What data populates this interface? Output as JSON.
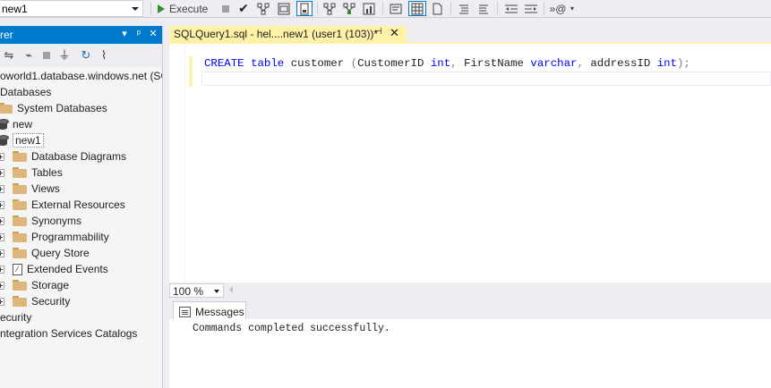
{
  "toolbar": {
    "database": "new1",
    "execute_label": "Execute"
  },
  "object_explorer": {
    "title": "rer",
    "pin_glyph": "▼ ⊥ ✕",
    "server": "oworld1.database.windows.net (SQ",
    "tree": [
      {
        "label": "Databases",
        "kind": "text",
        "indent": 0
      },
      {
        "label": "System Databases",
        "kind": "folder",
        "indent": 1
      },
      {
        "label": "new",
        "kind": "db",
        "indent": 1
      },
      {
        "label": "new1",
        "kind": "db",
        "indent": 1,
        "selected": true
      },
      {
        "label": "Database Diagrams",
        "kind": "folder",
        "indent": 2,
        "expand": true
      },
      {
        "label": "Tables",
        "kind": "folder",
        "indent": 2,
        "expand": true
      },
      {
        "label": "Views",
        "kind": "folder",
        "indent": 2,
        "expand": true
      },
      {
        "label": "External Resources",
        "kind": "folder",
        "indent": 2,
        "expand": true
      },
      {
        "label": "Synonyms",
        "kind": "folder",
        "indent": 2,
        "expand": true
      },
      {
        "label": "Programmability",
        "kind": "folder",
        "indent": 2,
        "expand": true
      },
      {
        "label": "Query Store",
        "kind": "folder",
        "indent": 2,
        "expand": true
      },
      {
        "label": "Extended Events",
        "kind": "events",
        "indent": 2,
        "expand": true
      },
      {
        "label": "Storage",
        "kind": "folder",
        "indent": 2,
        "expand": true
      },
      {
        "label": "Security",
        "kind": "folder",
        "indent": 2,
        "expand": true
      },
      {
        "label": "ecurity",
        "kind": "text",
        "indent": 0
      },
      {
        "label": "ntegration Services Catalogs",
        "kind": "text",
        "indent": 0
      }
    ]
  },
  "editor": {
    "tab_title": "SQLQuery1.sql - hel....new1 (user1 (103))*",
    "code": {
      "create": "CREATE",
      "table": "table",
      "name": "customer",
      "p1": "(",
      "col1": "CustomerID",
      "int1": "int",
      "c1": ",",
      "col2": "FirstName",
      "varchar": "varchar",
      "c2": ",",
      "col3": "addressID",
      "int2": "int",
      "p2": ");"
    },
    "zoom": "100 %"
  },
  "results": {
    "messages_tab": "Messages",
    "output": "Commands completed successfully."
  }
}
